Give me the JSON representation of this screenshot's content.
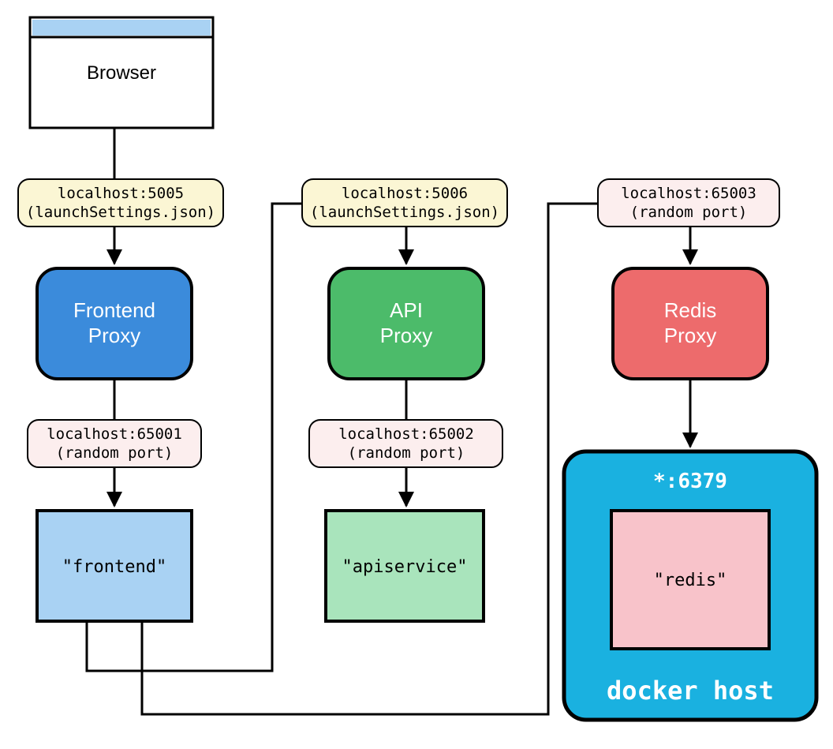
{
  "browser": {
    "label": "Browser"
  },
  "edges": {
    "e1": {
      "line1": "localhost:5005",
      "line2": "(launchSettings.json)"
    },
    "e2": {
      "line1": "localhost:5006",
      "line2": "(launchSettings.json)"
    },
    "e3": {
      "line1": "localhost:65003",
      "line2": "(random port)"
    },
    "e4": {
      "line1": "localhost:65001",
      "line2": "(random port)"
    },
    "e5": {
      "line1": "localhost:65002",
      "line2": "(random port)"
    }
  },
  "proxies": {
    "frontend": {
      "line1": "Frontend",
      "line2": "Proxy"
    },
    "api": {
      "line1": "API",
      "line2": "Proxy"
    },
    "redis": {
      "line1": "Redis",
      "line2": "Proxy"
    }
  },
  "services": {
    "frontend": {
      "label": "\"frontend\""
    },
    "apiservice": {
      "label": "\"apiservice\""
    },
    "redis": {
      "label": "\"redis\""
    }
  },
  "docker": {
    "port": "*:6379",
    "label": "docker host"
  },
  "colors": {
    "yellow": "#FBF6D4",
    "pink": "#FCEEEE",
    "blue": "#3B8BDB",
    "green": "#4CBB6A",
    "red": "#ED6B6C",
    "lblue": "#A9D2F3",
    "lgreen": "#A9E4BC",
    "lpink": "#F8C3CA",
    "cyan": "#1AB1E0",
    "browserTop": "#A9D2F3"
  }
}
